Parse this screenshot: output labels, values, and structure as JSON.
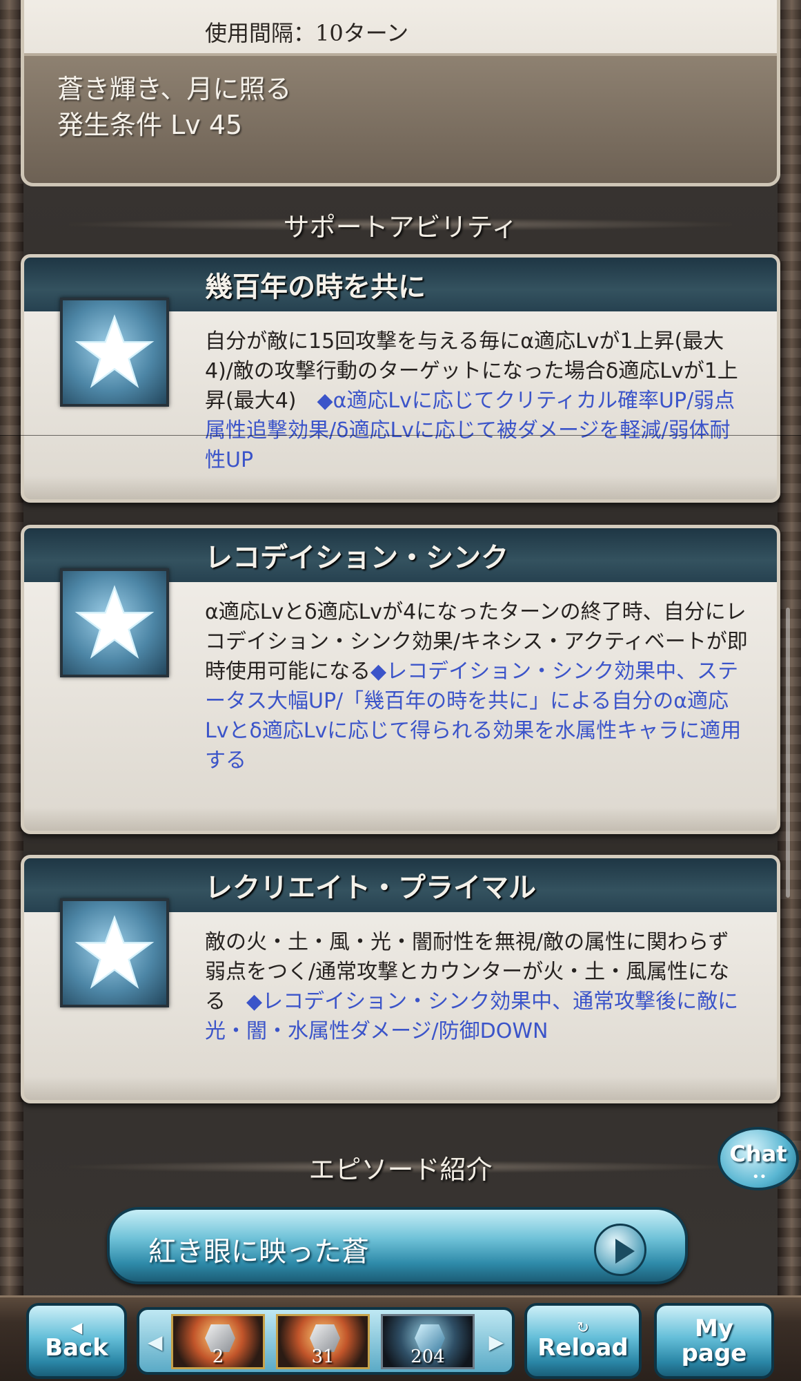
{
  "top_ability": {
    "interval": "使用間隔：10ターン",
    "condition_name": "蒼き輝き、月に照る",
    "condition_level": "発生条件 Lv 45"
  },
  "support_section": {
    "title": "サポートアビリティ"
  },
  "support_abilities": [
    {
      "name": "幾百年の時を共に",
      "icon": "star-icon",
      "desc_black": "自分が敵に15回攻撃を与える毎にα適応Lvが1上昇(最大4)/敵の攻撃行動のターゲットになった場合δ適応Lvが1上昇(最大4)　",
      "desc_blue": "◆α適応Lvに応じてクリティカル確率UP/弱点属性追撃効果/δ適応Lvに応じて被ダメージを軽減/弱体耐性UP"
    },
    {
      "name": "レコデイション・シンク",
      "icon": "star-icon",
      "desc_black": "α適応Lvとδ適応Lvが4になったターンの終了時、自分にレコデイション・シンク効果/キネシス・アクティベートが即時使用可能になる",
      "desc_blue": "◆レコデイション・シンク効果中、ステータス大幅UP/「幾百年の時を共に」による自分のα適応Lvとδ適応Lvに応じて得られる効果を水属性キャラに適用する"
    },
    {
      "name": "レクリエイト・プライマル",
      "icon": "star-icon",
      "desc_black": "敵の火・土・風・光・闇耐性を無視/敵の属性に関わらず弱点をつく/通常攻撃とカウンターが火・土・風属性になる　",
      "desc_blue": "◆レコデイション・シンク効果中、通常攻撃後に敵に光・闇・水属性ダメージ/防御DOWN"
    }
  ],
  "episode_section": {
    "title": "エピソード紹介"
  },
  "episode_button": {
    "label": "紅き眼に映った蒼",
    "icon": "play-icon"
  },
  "chat": {
    "label": "Chat",
    "dots": "••"
  },
  "footer": {
    "back_label": "Back",
    "back_arrow": "◀",
    "reload_label": "Reload",
    "reload_icon": "↻",
    "mypage_label_1": "My",
    "mypage_label_2": "page",
    "tray_left": "◀",
    "tray_right": "▶",
    "items": [
      {
        "count": "2",
        "icon": "silver-gem-icon"
      },
      {
        "count": "31",
        "icon": "silver-gem-icon"
      },
      {
        "count": "204",
        "icon": "blue-crystal-icon"
      }
    ]
  },
  "colors": {
    "accent_blue_text": "#3b54c9",
    "title_bar": "#1e3644",
    "button_cyan": "#65bfd9"
  }
}
